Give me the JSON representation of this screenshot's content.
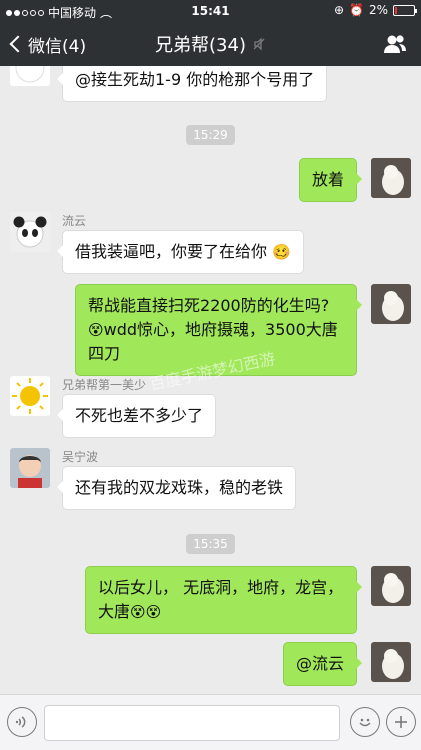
{
  "status": {
    "carrier": "中国移动",
    "time": "15:41",
    "battery": "2%"
  },
  "nav": {
    "back_label": "微信(4)",
    "title": "兄弟帮(34)"
  },
  "colors": {
    "bubble_out": "#a0e75a",
    "bubble_in": "#ffffff",
    "bar": "#2e3134"
  },
  "messages": {
    "m0": {
      "text": "@接生死劫1-9 你的枪那个号用了"
    },
    "t1": "15:29",
    "m1": {
      "text": "放着"
    },
    "m2": {
      "sender": "流云",
      "text": "借我装逼吧，你要了在给你"
    },
    "m3": {
      "line1": "帮战能直接扫死2200防的化生吗?",
      "line2": "wdd惊心，地府摄魂，3500大唐",
      "line3": "四刀"
    },
    "m4": {
      "sender": "兄弟帮第一美少",
      "text": "不死也差不多少了"
    },
    "m5": {
      "sender": "吴宁波",
      "text": "还有我的双龙戏珠，稳的老铁"
    },
    "t2": "15:35",
    "m6": {
      "line1": "以后女儿， 无底洞，地府，龙宫，",
      "line2": "大唐"
    },
    "m7": {
      "text": "@流云"
    }
  },
  "watermark": "百度手游梦幻西游",
  "icons": [
    "back-chevron-icon",
    "mute-icon",
    "group-members-icon",
    "voice-icon",
    "emoji-icon",
    "plus-icon"
  ]
}
